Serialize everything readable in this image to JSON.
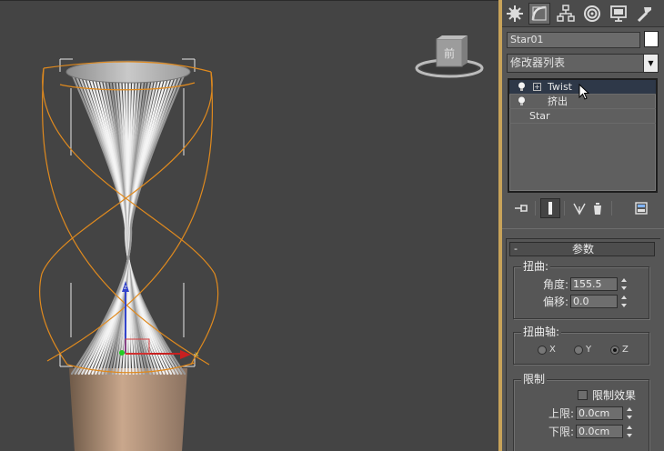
{
  "command_panel": {
    "tabs": [
      {
        "name": "create-tab",
        "icon": "create-icon"
      },
      {
        "name": "modify-tab",
        "icon": "modify-icon"
      },
      {
        "name": "hierarchy-tab",
        "icon": "hierarchy-icon"
      },
      {
        "name": "motion-tab",
        "icon": "motion-icon"
      },
      {
        "name": "display-tab",
        "icon": "display-icon"
      },
      {
        "name": "utilities-tab",
        "icon": "utilities-icon"
      }
    ],
    "active_tab": "modify-tab",
    "object_name": "Star01",
    "object_color": "#ffffff",
    "modifier_list_label": "修改器列表",
    "stack": [
      {
        "label": "Twist",
        "selected": true
      },
      {
        "label": "挤出",
        "selected": false
      },
      {
        "label": "Star",
        "selected": false
      }
    ],
    "stack_tools": [
      "pin-stack-icon",
      "show-end-result-icon",
      "make-unique-icon",
      "remove-modifier-icon",
      "configure-sets-icon"
    ]
  },
  "parameters": {
    "rollout_title": "参数",
    "rollout_toggle": "-",
    "twist_group": {
      "title": "扭曲:",
      "angle_label": "角度:",
      "angle_value": "155.5",
      "bias_label": "偏移:",
      "bias_value": "0.0"
    },
    "axis_group": {
      "title": "扭曲轴:",
      "options": [
        "X",
        "Y",
        "Z"
      ],
      "selected": "Z"
    },
    "limits_group": {
      "title": "限制",
      "limit_effect_label": "限制效果",
      "limit_effect_checked": false,
      "upper_label": "上限:",
      "upper_value": "0.0cm",
      "lower_label": "下限:",
      "lower_value": "0.0cm"
    }
  },
  "viewport": {
    "viewcube_label": "前",
    "background_color": "#444444",
    "gizmo_color": "#e08a1e"
  }
}
